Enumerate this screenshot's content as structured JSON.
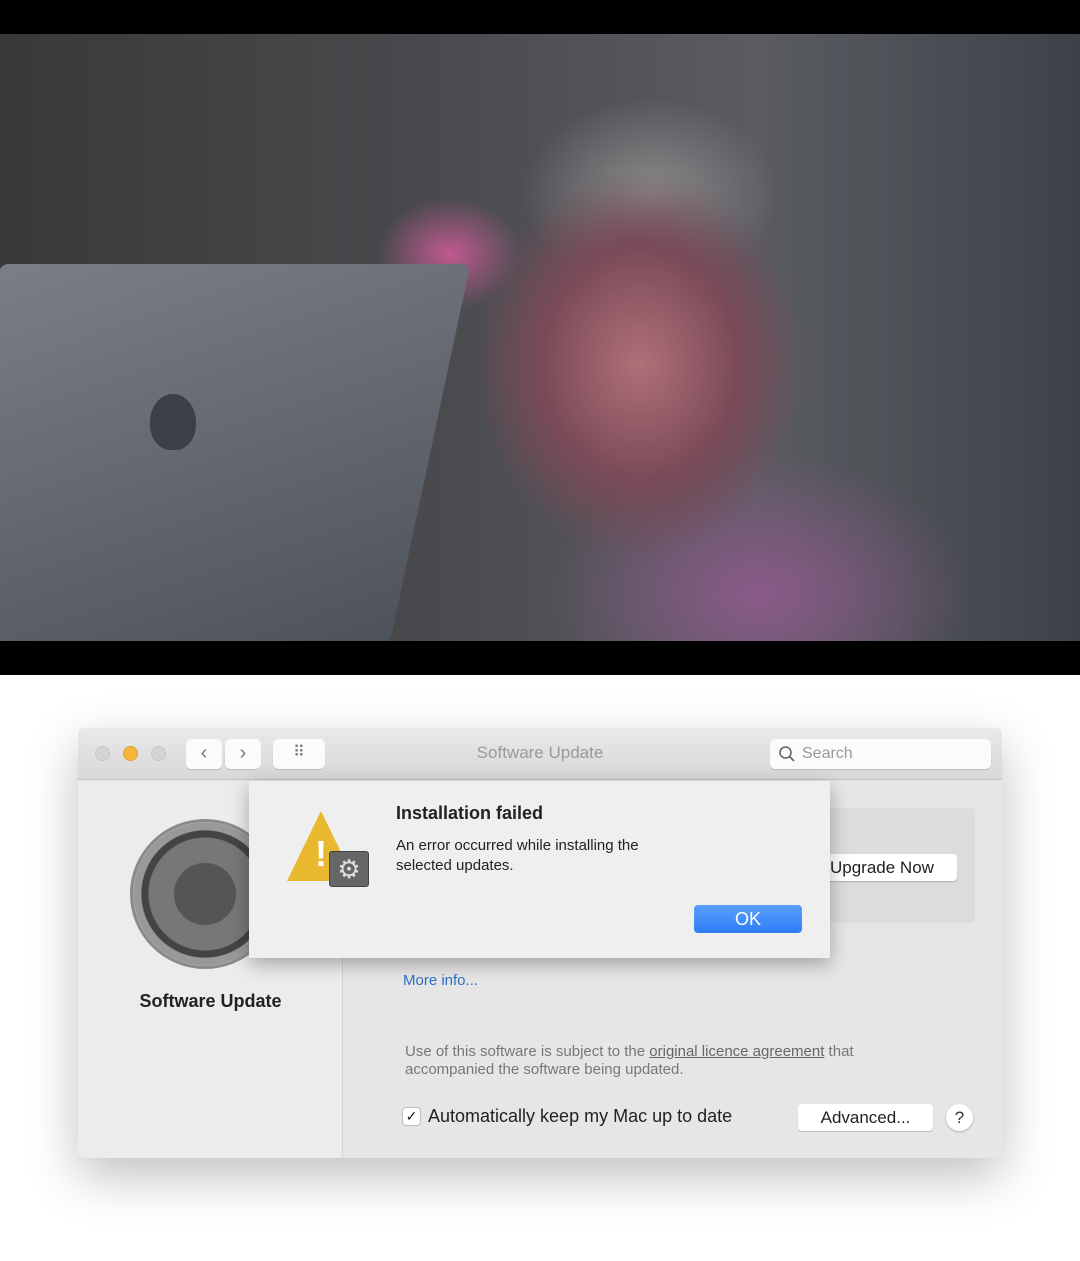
{
  "window": {
    "title": "Software Update",
    "search_placeholder": "Search",
    "nav_back": "‹",
    "nav_forward": "›",
    "grid": "⠿"
  },
  "sidebar": {
    "label": "Software Update",
    "icon": "gear-icon"
  },
  "content": {
    "upgrade_button": "Upgrade Now",
    "more_info": "More info...",
    "licence_pre": "Use of this software is subject to the ",
    "licence_link": "original licence agreement",
    "licence_post": " that accompanied the software being updated.",
    "auto_update_label": "Automatically keep my Mac up to date",
    "auto_update_checked": true,
    "checkmark": "✓",
    "advanced_button": "Advanced...",
    "help_button": "?"
  },
  "dialog": {
    "title": "Installation failed",
    "message": "An error occurred while installing the selected updates.",
    "ok_button": "OK",
    "warning_mark": "!",
    "badge_glyph": "⚙"
  },
  "colors": {
    "accent": "#2f7cf6",
    "link": "#2f6fc7",
    "minimize": "#f5b73a"
  }
}
